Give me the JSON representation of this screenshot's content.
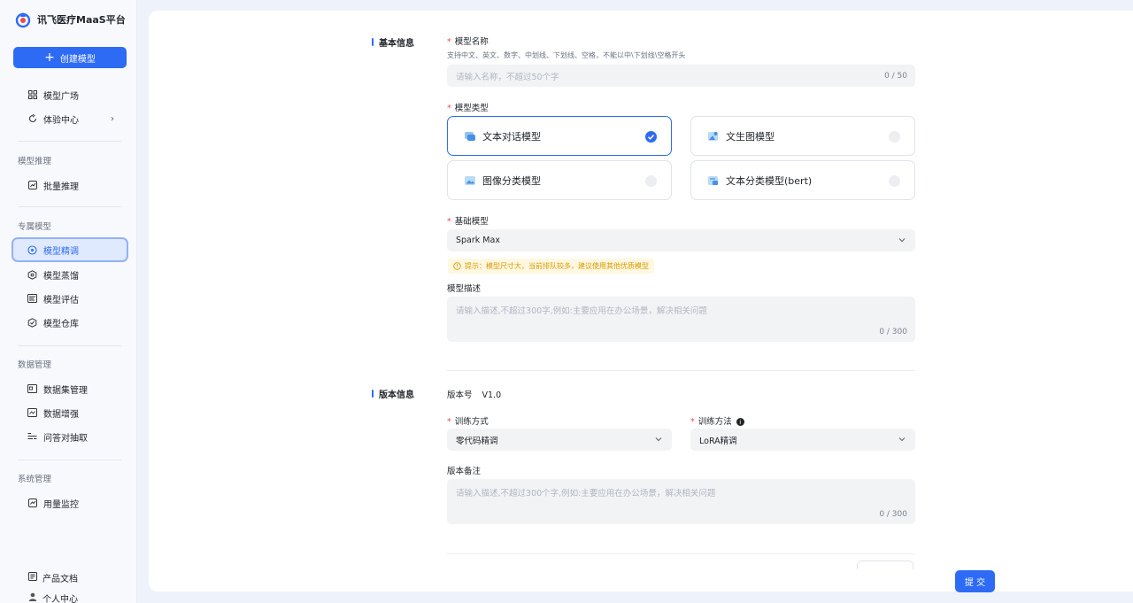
{
  "app": {
    "title": "讯飞医疗MaaS平台"
  },
  "sidebar": {
    "create_label": "创建模型",
    "top_items": [
      {
        "label": "模型广场",
        "icon": "grid-icon"
      },
      {
        "label": "体验中心",
        "icon": "refresh-icon"
      }
    ],
    "groups": [
      {
        "title": "模型推理",
        "items": [
          {
            "label": "批量推理",
            "icon": "chart-icon"
          }
        ]
      },
      {
        "title": "专属模型",
        "items": [
          {
            "label": "模型精调",
            "icon": "tune-icon",
            "active": true
          },
          {
            "label": "模型蒸馏",
            "icon": "distill-icon"
          },
          {
            "label": "模型评估",
            "icon": "eval-icon"
          },
          {
            "label": "模型仓库",
            "icon": "repo-icon"
          }
        ]
      },
      {
        "title": "数据管理",
        "items": [
          {
            "label": "数据集管理",
            "icon": "dataset-icon"
          },
          {
            "label": "数据增强",
            "icon": "enhance-icon"
          },
          {
            "label": "问答对抽取",
            "icon": "qa-icon"
          }
        ]
      },
      {
        "title": "系统管理",
        "items": [
          {
            "label": "用量监控",
            "icon": "monitor-icon"
          }
        ]
      }
    ],
    "bottom_items": [
      {
        "label": "产品文档",
        "icon": "doc-icon"
      },
      {
        "label": "个人中心",
        "icon": "user-icon"
      }
    ]
  },
  "form": {
    "basic_section": "基本信息",
    "model_name": {
      "label": "模型名称",
      "hint": "支持中文、英文、数字、中划线、下划线、空格，不能以中\\下划线\\空格开头",
      "placeholder": "请输入名称，不超过50个字",
      "count": "0 / 50"
    },
    "model_type": {
      "label": "模型类型",
      "options": [
        {
          "label": "文本对话模型",
          "selected": true
        },
        {
          "label": "文生图模型",
          "selected": false
        },
        {
          "label": "图像分类模型",
          "selected": false
        },
        {
          "label": "文本分类模型(bert)",
          "selected": false
        }
      ]
    },
    "base_model": {
      "label": "基础模型",
      "value": "Spark Max",
      "tip": "提示：模型尺寸大，当前排队较多，建议使用其他优质模型"
    },
    "model_desc": {
      "label": "模型描述",
      "placeholder": "请输入描述,不超过300字,例如:主要应用在办公场景，解决相关问题",
      "count": "0 / 300"
    },
    "version_section": "版本信息",
    "version": {
      "label": "版本号",
      "value": "V1.0"
    },
    "train_mode": {
      "label": "训练方式",
      "value": "零代码精调"
    },
    "train_method": {
      "label": "训练方法",
      "value": "LoRA精调"
    },
    "version_note": {
      "label": "版本备注",
      "placeholder": "请输入描述,不超过300个字,例如:主要应用在办公场景，解决相关问题",
      "count": "0 / 300"
    },
    "submit_label": "提 交"
  },
  "colors": {
    "accent": "#2e6bf5",
    "required": "#f04b4b",
    "tip_bg": "#fff7e0",
    "tip_text": "#d99a00"
  }
}
